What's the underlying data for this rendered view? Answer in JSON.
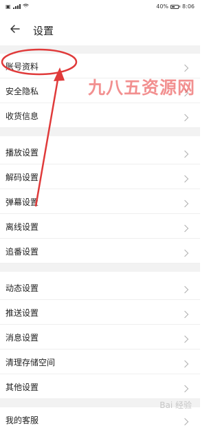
{
  "status_bar": {
    "battery": "40%",
    "time": "8:06"
  },
  "header": {
    "title": "设置"
  },
  "groups": [
    {
      "items": [
        "账号资料",
        "安全隐私",
        "收货信息"
      ]
    },
    {
      "items": [
        "播放设置",
        "解码设置",
        "弹幕设置",
        "离线设置",
        "追番设置"
      ]
    },
    {
      "items": [
        "动态设置",
        "推送设置",
        "消息设置",
        "清理存储空间",
        "其他设置"
      ]
    },
    {
      "items": [
        "我的客服"
      ]
    }
  ],
  "overlay": {
    "watermark": "九八五资源网",
    "baidu_watermark": "Bai 经验",
    "annotation_color": "#e03a3a"
  },
  "colors": {
    "background": "#ffffff",
    "separator": "#f2f2f2",
    "text": "#222222",
    "chevron": "#b5b5b5"
  },
  "icons": [
    "back-arrow-icon",
    "chevron-right-icon",
    "battery-icon",
    "wifi-icon",
    "signal-icon"
  ]
}
